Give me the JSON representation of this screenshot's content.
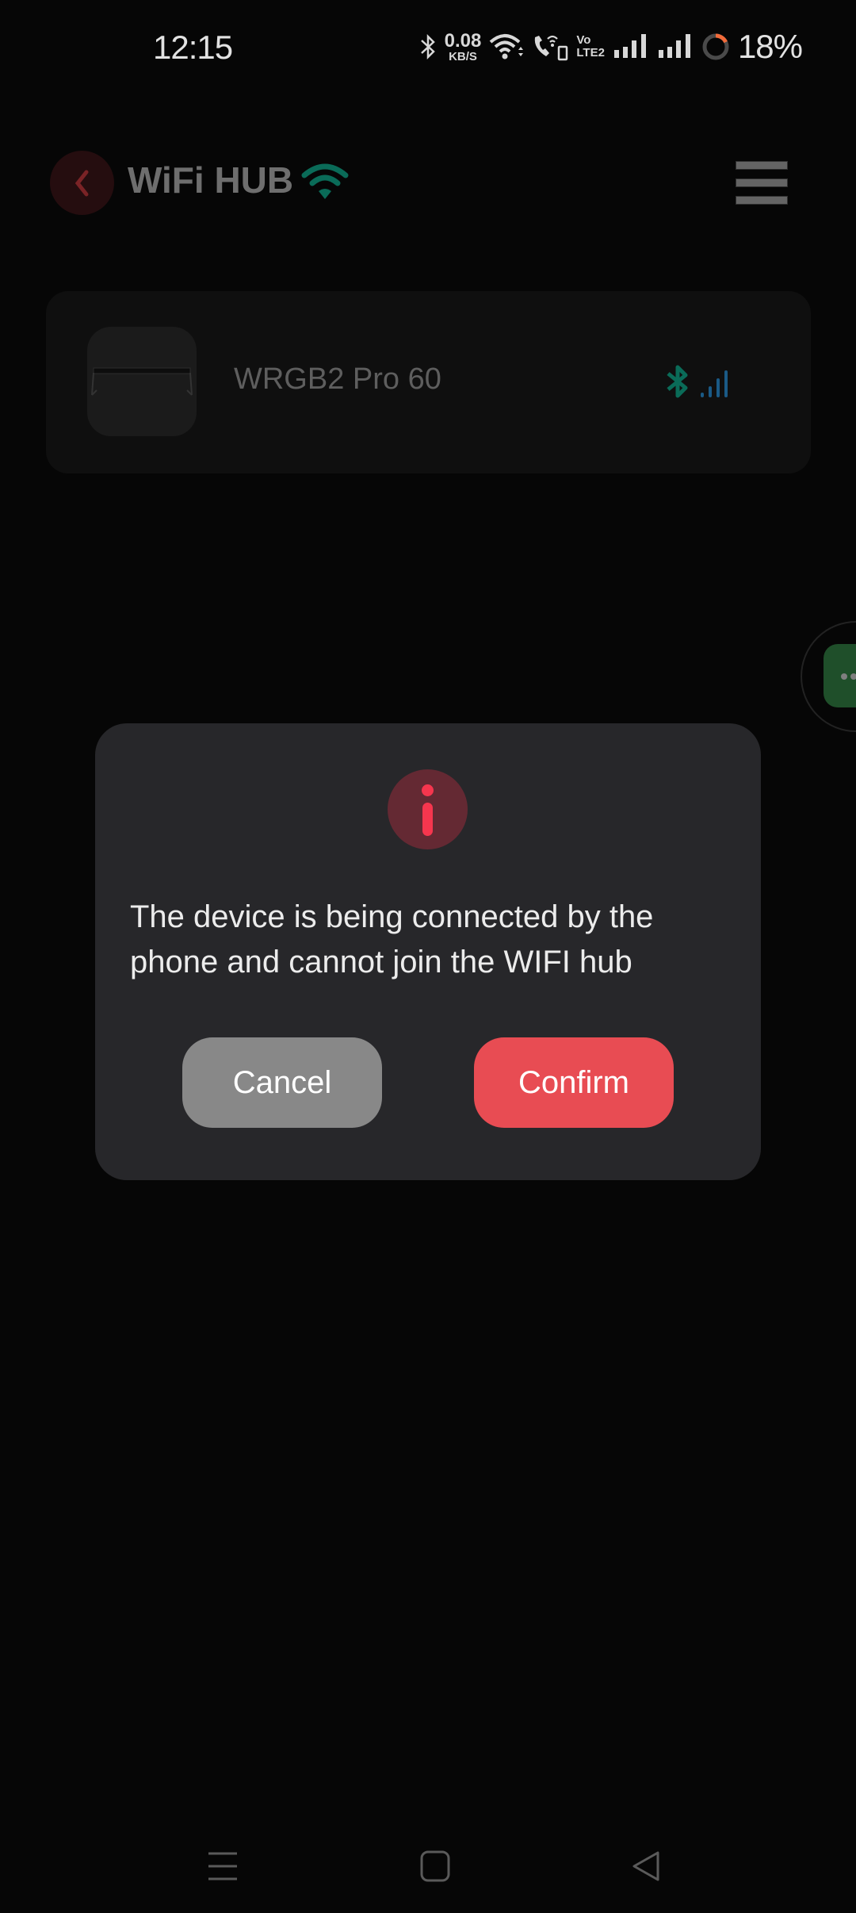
{
  "status_bar": {
    "time": "12:15",
    "net_speed_value": "0.08",
    "net_speed_unit": "KB/S",
    "volte_top": "Vo",
    "volte_bottom": "LTE2",
    "battery_percent": "18%",
    "battery_level": 0.18,
    "icons": [
      "bluetooth-icon",
      "wifi-icon",
      "wifi-calling-icon",
      "volte-icon",
      "signal-sim1-icon",
      "signal-sim2-icon",
      "battery-ring-icon"
    ]
  },
  "header": {
    "title": "WiFi HUB",
    "back_icon": "chevron-left-icon",
    "status_icon": "wifi-icon",
    "menu_icon": "hamburger-menu-icon"
  },
  "device": {
    "name": "WRGB2 Pro 60",
    "connection_icon": "bluetooth-icon",
    "signal_icon": "signal-bars-icon"
  },
  "dialog": {
    "icon": "info-icon",
    "message": "The device is being connected by the phone and cannot join the WIFI hub",
    "cancel_label": "Cancel",
    "confirm_label": "Confirm"
  },
  "colors": {
    "accent_red": "#e84c53",
    "info_red": "#f5364e",
    "wifi_teal": "#0a6b58",
    "signal_blue": "#1a5a86",
    "cancel_gray": "#888888",
    "dialog_bg": "#27272a"
  },
  "nav_bar": {
    "items": [
      "recents-icon",
      "home-icon",
      "back-icon"
    ]
  }
}
